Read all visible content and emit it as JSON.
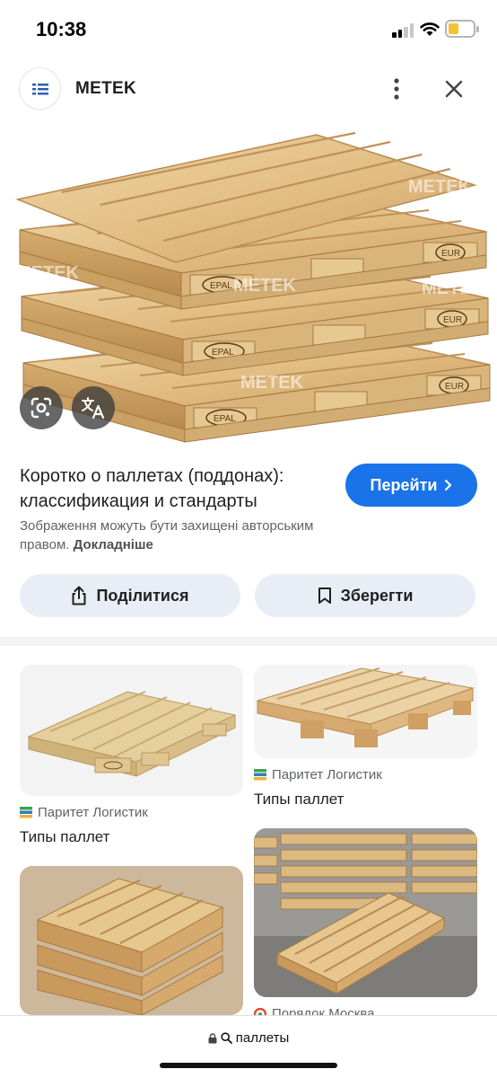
{
  "status": {
    "time": "10:38"
  },
  "header": {
    "site_name": "METEK"
  },
  "main_image": {
    "watermark": "METEK"
  },
  "result": {
    "title": "Коротко о паллетах (поддонах): классификация и стандарты",
    "visit_label": "Перейти",
    "copyright_text": "Зображення можуть бути захищені авторським правом.",
    "more_link": "Докладніше"
  },
  "actions": {
    "share_label": "Поділитися",
    "save_label": "Зберегти"
  },
  "related": [
    {
      "source": "Паритет Логистик",
      "title": "Типы паллет"
    },
    {
      "source": "Паритет Логистик",
      "title": "Типы паллет"
    },
    {
      "source": "Порядок Москва",
      "title": ""
    }
  ],
  "bottom_bar": {
    "query": "паллеты"
  },
  "icons": {
    "favicon": "list-icon",
    "more": "more-vert-icon",
    "close": "close-icon",
    "lens": "google-lens-icon",
    "translate": "translate-icon",
    "share": "share-icon",
    "save": "bookmark-icon",
    "lock": "lock-icon",
    "search": "search-icon"
  },
  "colors": {
    "accent": "#1a73e8",
    "chip_bg": "#e9eef6",
    "wood": "#e2bf85"
  }
}
